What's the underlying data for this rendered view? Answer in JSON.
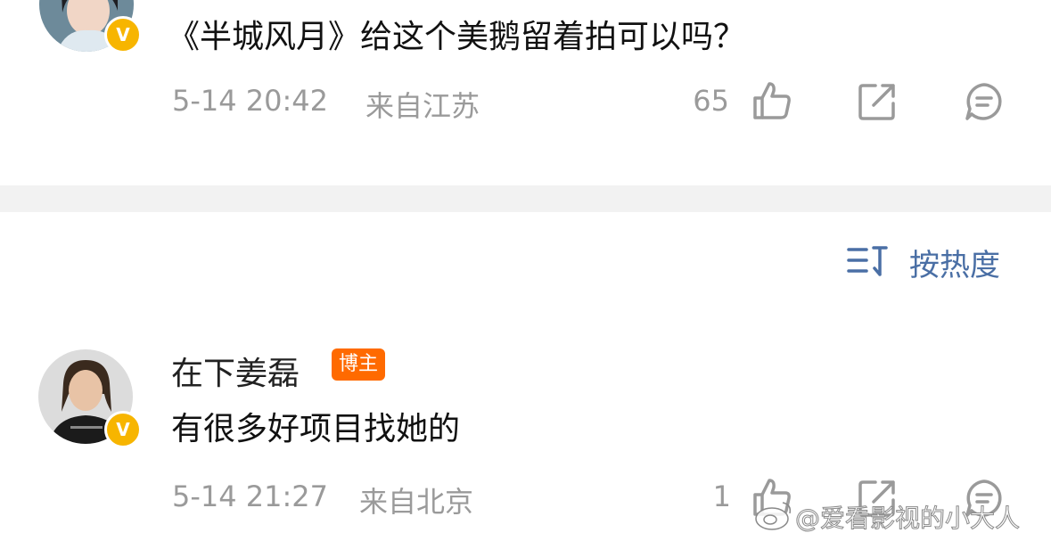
{
  "comment1": {
    "text": "《半城风月》给这个美鹅留着拍可以吗？",
    "time": "5-14 20:42",
    "location": "来自江苏",
    "like_count": "65",
    "verified": "V"
  },
  "sort": {
    "label": "按热度",
    "icon": "sort-icon"
  },
  "comment2": {
    "username": "在下姜磊",
    "role_badge": "博主",
    "text": "有很多好项目找她的",
    "time": "5-14 21:27",
    "location": "来自北京",
    "like_count": "1",
    "verified": "V"
  },
  "watermark": {
    "text": "@爱看影视的小大人"
  },
  "colors": {
    "meta_gray": "#9a9a9a",
    "link_blue": "#4a6fa5",
    "badge_orange": "#ff6a00",
    "verified_yellow": "#f7b500",
    "divider_gray": "#f2f2f2"
  },
  "icons": [
    "like-icon",
    "share-icon",
    "comment-icon",
    "sort-icon",
    "verified-icon",
    "weibo-logo-icon"
  ]
}
